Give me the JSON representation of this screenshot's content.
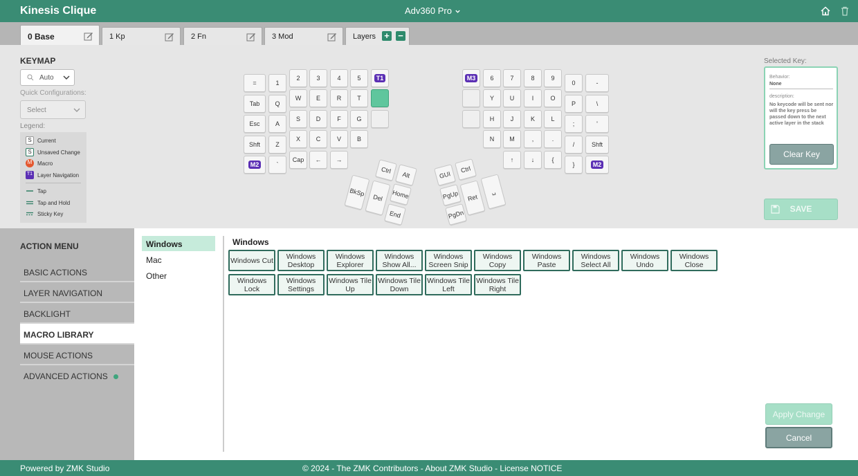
{
  "header": {
    "app_title": "Kinesis Clique",
    "model": "Adv360 Pro",
    "home_icon": "home-icon",
    "trash_icon": "trash-icon"
  },
  "tabs": [
    {
      "label": "0 Base"
    },
    {
      "label": "1 Kp"
    },
    {
      "label": "2 Fn"
    },
    {
      "label": "3 Mod"
    }
  ],
  "layers_label": "Layers",
  "keymap": {
    "title": "KEYMAP",
    "auto_select": "Auto",
    "quick_config_label": "Quick Configurations:",
    "quick_config_select": "Select",
    "legend_label": "Legend:",
    "legend": {
      "current": {
        "glyph": "S",
        "label": "Current"
      },
      "unsaved": {
        "glyph": "S",
        "label": "Unsaved Change"
      },
      "macro": {
        "glyph": "M",
        "label": "Macro"
      },
      "layer_nav": {
        "glyph": "T1",
        "label": "Layer Navigation"
      },
      "tap": "Tap",
      "tap_hold": "Tap and Hold",
      "sticky": "Sticky Key"
    }
  },
  "keys": {
    "left": {
      "eq": "=",
      "n1": "1",
      "n2": "2",
      "n3": "3",
      "n4": "4",
      "n5": "5",
      "t1": "T1",
      "tab": "Tab",
      "q": "Q",
      "w": "W",
      "e": "E",
      "r": "R",
      "t": "T",
      "esc": "Esc",
      "a": "A",
      "s": "S",
      "d": "D",
      "f": "F",
      "g": "G",
      "shft": "Shft",
      "z": "Z",
      "x": "X",
      "c": "C",
      "v": "V",
      "b": "B",
      "m2": "M2",
      "backtick": "`",
      "cap": "Cap",
      "left": "←",
      "right": "→",
      "ctrl": "Ctrl",
      "alt": "Alt",
      "bksp": "BkSp",
      "del": "Del",
      "home": "Home",
      "end": "End"
    },
    "right": {
      "m3": "M3",
      "n6": "6",
      "n7": "7",
      "n8": "8",
      "n9": "9",
      "n0": "0",
      "minus": "-",
      "y": "Y",
      "u": "U",
      "i": "I",
      "o": "O",
      "p": "P",
      "bslash": "\\",
      "h": "H",
      "j": "J",
      "k": "K",
      "l": "L",
      "semi": ";",
      "quote": "'",
      "n": "N",
      "m": "M",
      "comma": ",",
      "period": ".",
      "slash": "/",
      "shft": "Shft",
      "up": "↑",
      "down": "↓",
      "lbrace": "{",
      "rbrace": "}",
      "m2": "M2",
      "gui": "GUI",
      "ctrl": "Ctrl",
      "pgup": "PgUp",
      "pgdn": "PgDn",
      "ret": "Ret",
      "spc": "␣"
    }
  },
  "selected_key": {
    "title": "Selected Key:",
    "behavior_label": "Behavior:",
    "behavior_value": "None",
    "description_label": "description:",
    "description": "No keycode will be sent nor will the key press be passed down to the next active layer in the stack",
    "clear_button": "Clear Key",
    "save_button": "SAVE"
  },
  "action_menu": {
    "title": "ACTION MENU",
    "items": [
      {
        "label": "BASIC ACTIONS"
      },
      {
        "label": "LAYER NAVIGATION"
      },
      {
        "label": "BACKLIGHT"
      },
      {
        "label": "MACRO LIBRARY"
      },
      {
        "label": "MOUSE ACTIONS"
      },
      {
        "label": "ADVANCED ACTIONS"
      }
    ]
  },
  "categories": [
    "Windows",
    "Mac",
    "Other"
  ],
  "section_title": "Windows",
  "macros": [
    "Windows Cut",
    "Windows Desktop",
    "Windows Explorer",
    "Windows Show All...",
    "Windows Screen Snip",
    "Windows Copy",
    "Windows Paste",
    "Windows Select All",
    "Windows Undo",
    "Windows Close",
    "Windows Lock",
    "Windows Settings",
    "Windows Tile Up",
    "Windows Tile Down",
    "Windows Tile Left",
    "Windows Tile Right"
  ],
  "buttons": {
    "apply": "Apply Change",
    "cancel": "Cancel"
  },
  "footer": {
    "left": "Powered by ZMK Studio",
    "center": "© 2024 - The ZMK Contributors - About ZMK Studio - License NOTICE"
  }
}
